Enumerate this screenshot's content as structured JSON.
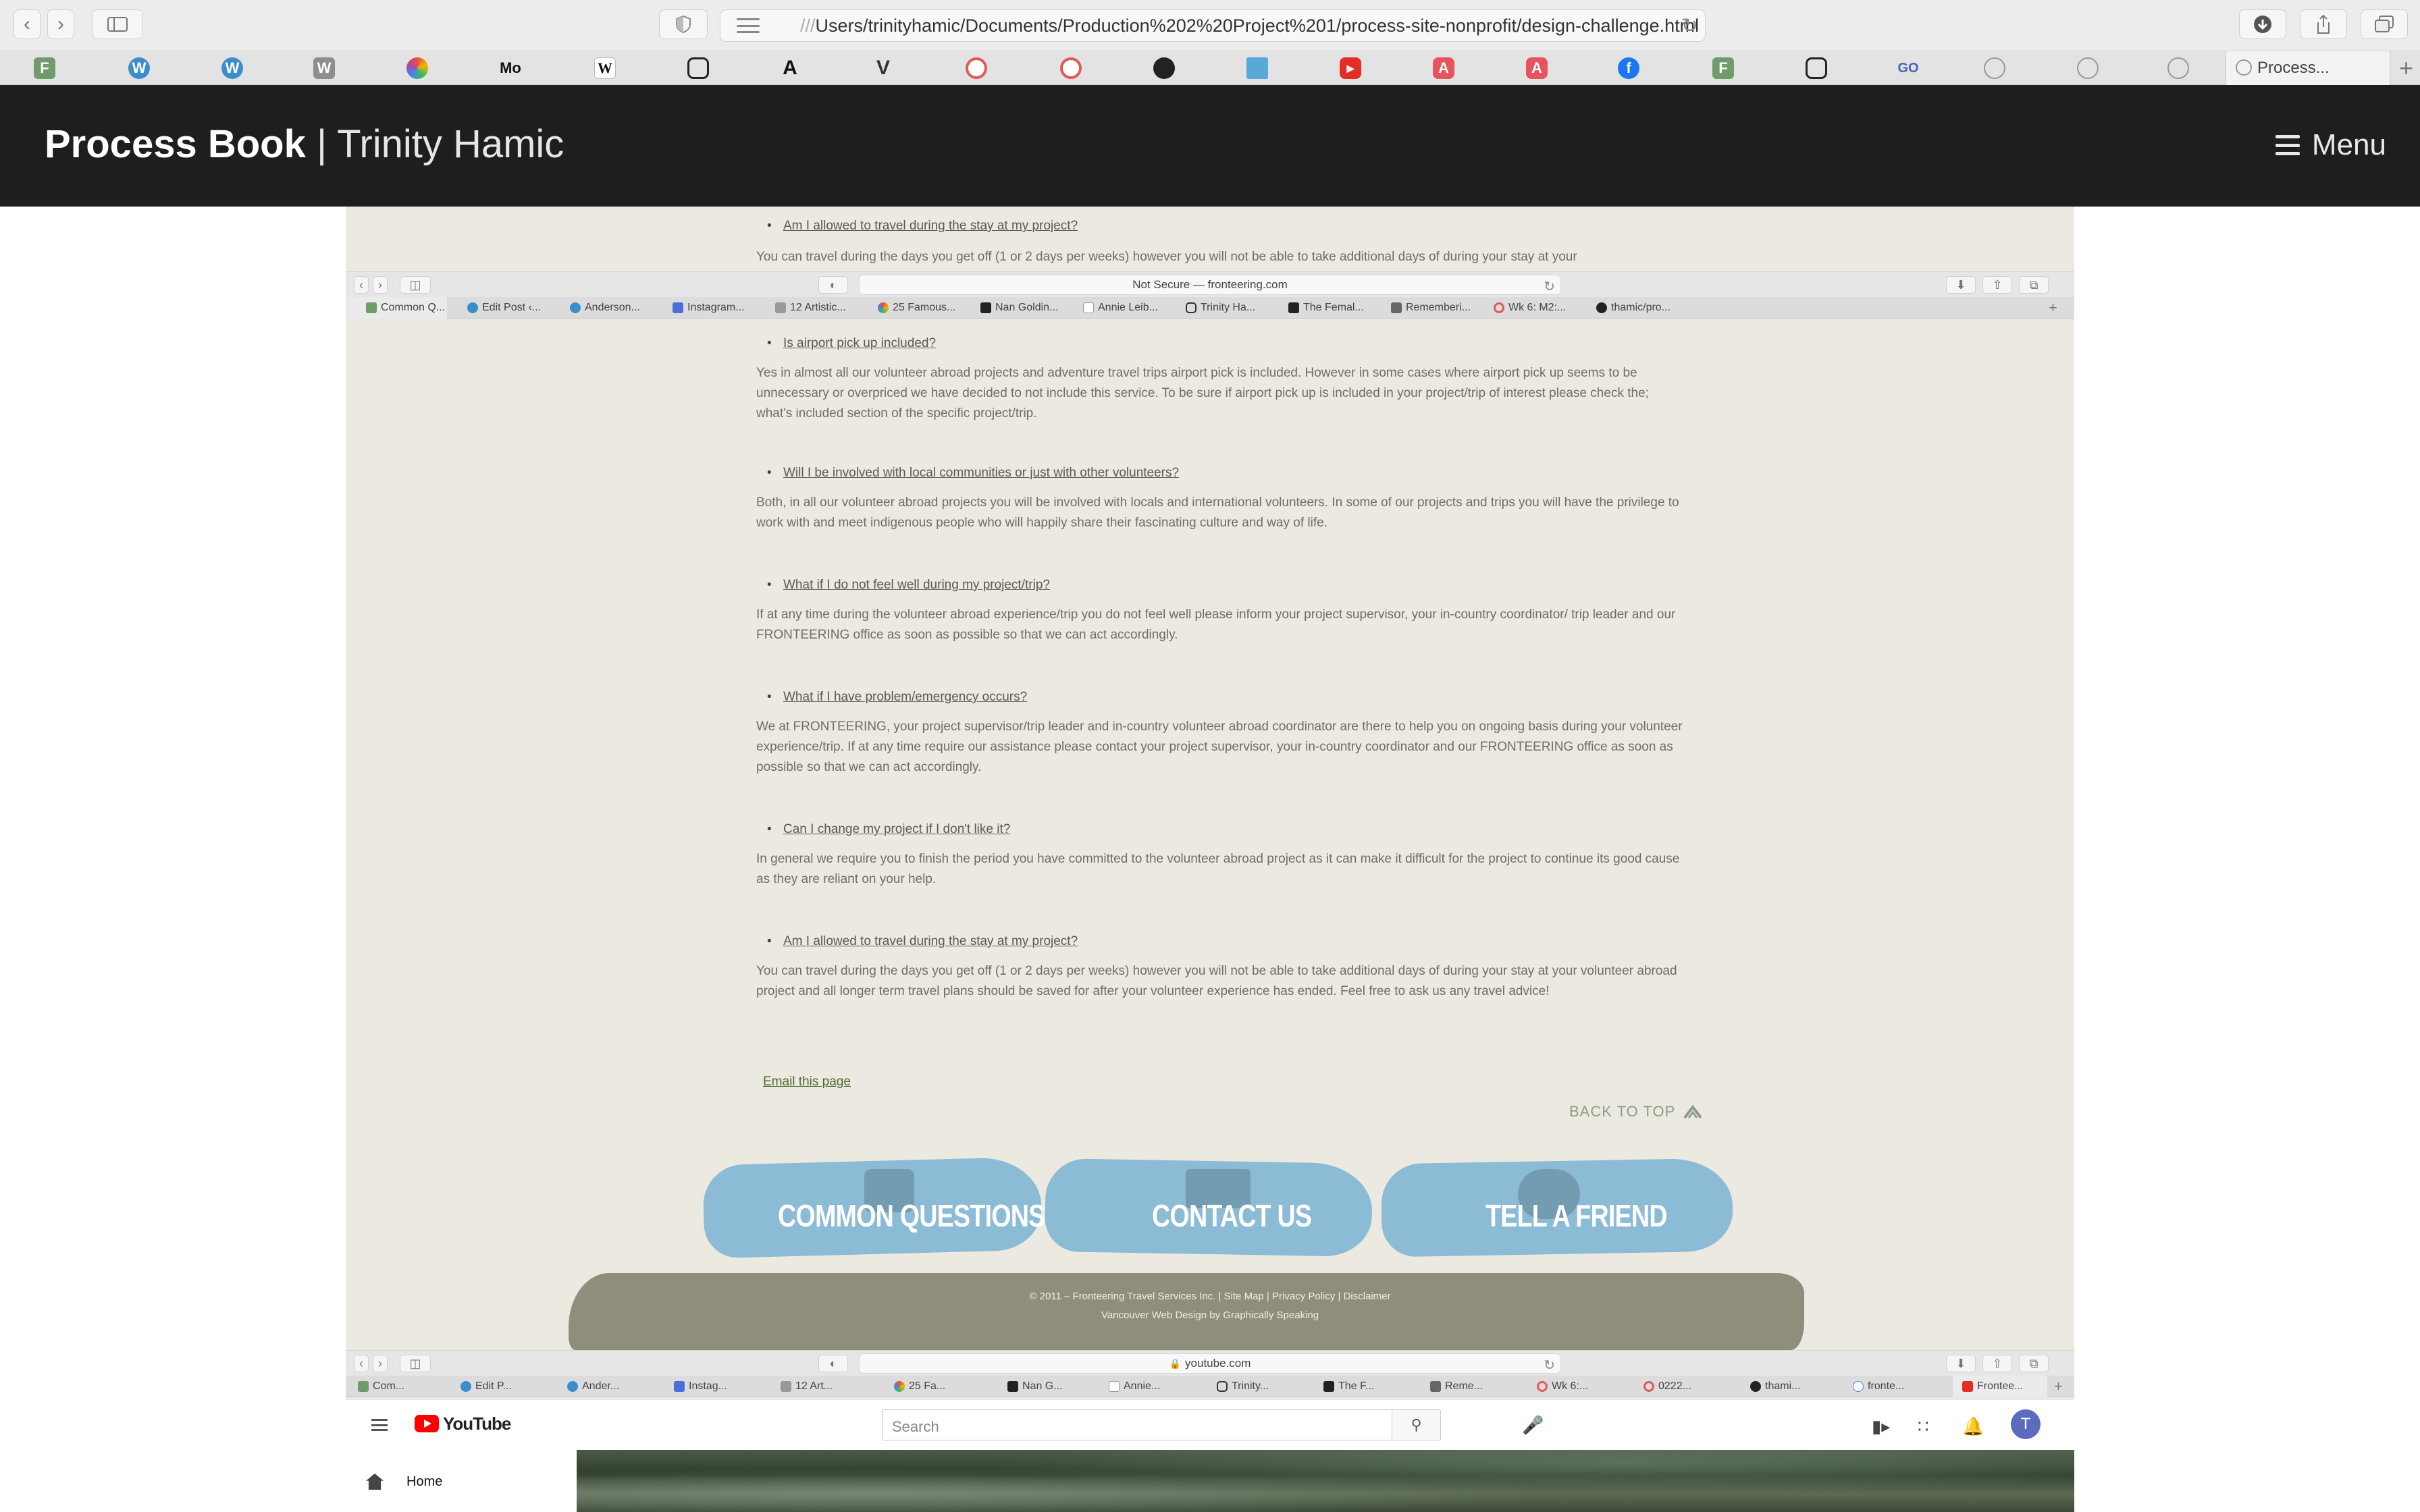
{
  "browser": {
    "url_prefix": "///",
    "url": "Users/trinityhamic/Documents/Production%202%20Project%201/process-site-nonprofit/design-challenge.html",
    "active_tab": "Process..."
  },
  "header": {
    "title_bold": "Process Book",
    "title_sep": "|",
    "title_name": "Trinity Hamic",
    "menu_label": "Menu"
  },
  "embed": {
    "top_partial": {
      "question": "Am I allowed to travel during the stay at my project?",
      "answer_cut": "You can travel during the days you get off (1 or 2 days per weeks) however you will not be able to take additional days of during your stay at your"
    },
    "browser1": {
      "url": "Not Secure — fronteering.com",
      "tabs": [
        "Common Q...",
        "Edit Post ‹...",
        "Anderson...",
        "Instagram...",
        "12 Artistic...",
        "25 Famous...",
        "Nan Goldin...",
        "Annie Leib...",
        "Trinity Ha...",
        "The Femal...",
        "Rememberi...",
        "Wk 6: M2:...",
        "thamic/pro..."
      ]
    },
    "faq": [
      {
        "question": "Is airport pick up included?",
        "answer": "Yes in almost all our volunteer abroad projects and adventure travel trips airport pick is included. However in some cases where airport pick up seems to be unnecessary or overpriced we have decided to not include this service. To be sure if airport pick up is included in your project/trip of interest please check the; what's included section of the specific project/trip."
      },
      {
        "question": "Will I be involved with local communities or just with other volunteers?",
        "answer": "Both, in all our volunteer abroad projects you will be involved with locals and international volunteers. In some of our projects and trips you will have the privilege to work with and meet indigenous people who will happily share their fascinating culture and way of life."
      },
      {
        "question": "What if I do not feel well during my project/trip?",
        "answer": "If at any time during the volunteer abroad experience/trip you do not feel well please inform your project supervisor, your in-country coordinator/ trip leader and our FRONTEERING office as soon as possible so that we can act accordingly."
      },
      {
        "question": "What if I have problem/emergency occurs?",
        "answer": "We at FRONTEERING, your project supervisor/trip leader and in-country volunteer abroad coordinator are there to help you on ongoing basis during your volunteer experience/trip. If at any time require our assistance please contact your project supervisor, your in-country coordinator and our FRONTEERING office as soon as possible so that we can act accordingly."
      },
      {
        "question": "Can I change my project if I don't like it?",
        "answer": "In general we require you to finish the period you have committed to the volunteer abroad project as it can make it difficult for the project to continue its good cause as they are reliant on your help."
      },
      {
        "question": "Am I allowed to travel during the stay at my project?",
        "answer": "You can travel during the days you get off (1 or 2 days per weeks) however you will not be able to take additional days of during your stay at your volunteer abroad project and all longer term travel plans should be saved for after your volunteer experience has ended. Feel free to ask us any travel advice!"
      }
    ],
    "email_link": "Email this page",
    "back_to_top": "BACK TO TOP",
    "footer": {
      "buttons": [
        "COMMON QUESTIONS",
        "CONTACT US",
        "TELL A FRIEND"
      ],
      "copyright": "© 2011 – Fronteering Travel Services Inc.  |  Site Map  |  Privacy Policy  |  Disclaimer",
      "credit": "Vancouver Web Design by Graphically Speaking"
    },
    "browser2": {
      "url": "youtube.com",
      "tabs": [
        "Com...",
        "Edit P...",
        "Ander...",
        "Instag...",
        "12 Art...",
        "25 Fa...",
        "Nan G...",
        "Annie...",
        "Trinity...",
        "The F...",
        "Reme...",
        "Wk 6:...",
        "0222...",
        "thami...",
        "fronte...",
        "Frontee..."
      ]
    },
    "youtube": {
      "brand": "YouTube",
      "search_placeholder": "Search",
      "avatar_letter": "T",
      "nav_home": "Home"
    }
  }
}
